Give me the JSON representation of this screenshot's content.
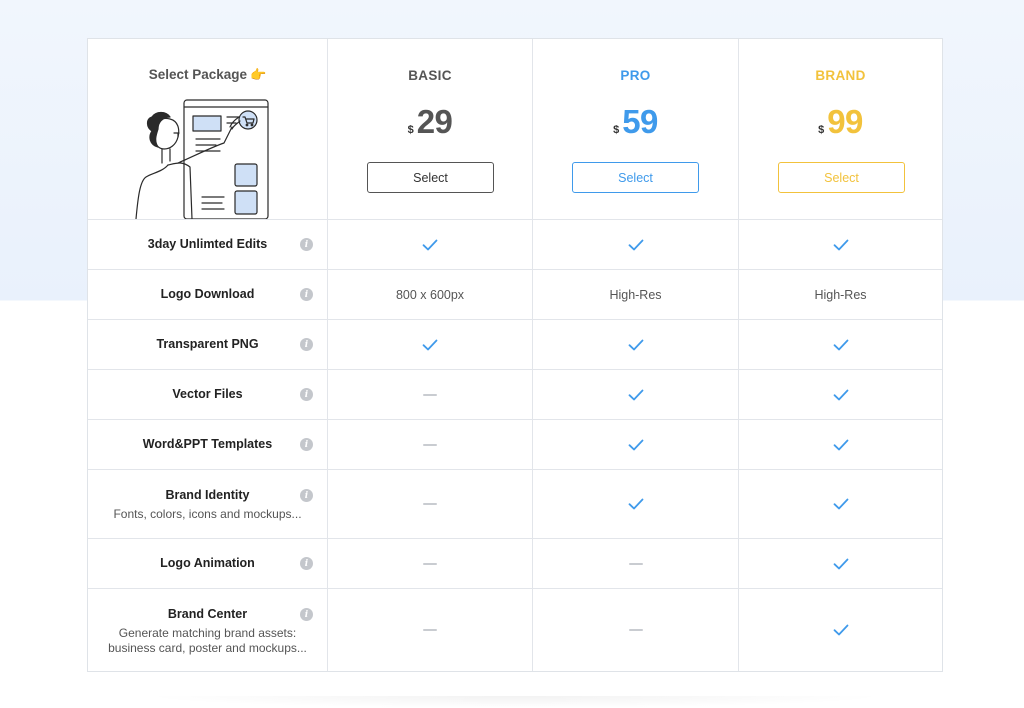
{
  "header": {
    "select_title": "Select Package",
    "hand_icon": "pointing-hand-icon"
  },
  "plans": [
    {
      "name": "BASIC",
      "currency": "$",
      "price": "29",
      "button_label": "Select",
      "color": "#555555"
    },
    {
      "name": "PRO",
      "currency": "$",
      "price": "59",
      "button_label": "Select",
      "color": "#3f9aeb"
    },
    {
      "name": "BRAND",
      "currency": "$",
      "price": "99",
      "button_label": "Select",
      "color": "#f2c23c"
    }
  ],
  "features": [
    {
      "title": "3day Unlimted Edits",
      "subtitle": "",
      "values": [
        "check",
        "check",
        "check"
      ]
    },
    {
      "title": "Logo Download",
      "subtitle": "",
      "values": [
        "800 x 600px",
        "High-Res",
        "High-Res"
      ]
    },
    {
      "title": "Transparent PNG",
      "subtitle": "",
      "values": [
        "check",
        "check",
        "check"
      ]
    },
    {
      "title": "Vector Files",
      "subtitle": "",
      "values": [
        "dash",
        "check",
        "check"
      ]
    },
    {
      "title": "Word&PPT Templates",
      "subtitle": "",
      "values": [
        "dash",
        "check",
        "check"
      ]
    },
    {
      "title": "Brand Identity",
      "subtitle": "Fonts, colors, icons and mockups...",
      "values": [
        "dash",
        "check",
        "check"
      ]
    },
    {
      "title": "Logo Animation",
      "subtitle": "",
      "values": [
        "dash",
        "dash",
        "check"
      ]
    },
    {
      "title": "Brand Center",
      "subtitle": "Generate matching brand assets:\nbusiness card, poster and mockups...",
      "values": [
        "dash",
        "dash",
        "check"
      ]
    }
  ],
  "colors": {
    "check": "#3f9aeb",
    "dash": "#c9ccd1",
    "info": "#c4c7cc"
  }
}
